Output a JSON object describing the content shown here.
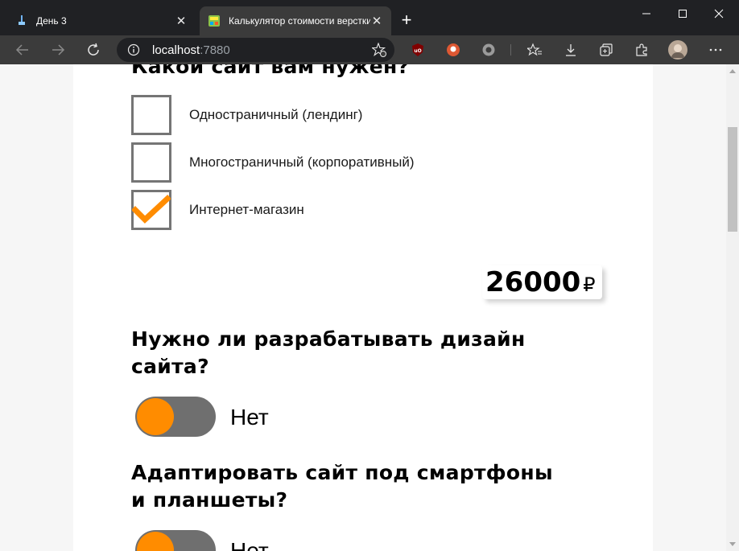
{
  "browser": {
    "tabs": [
      {
        "title": "День 3",
        "active": false
      },
      {
        "title": "Калькулятор стоимости верстки",
        "active": true
      }
    ],
    "address": {
      "host": "localhost",
      "port": ":7880"
    }
  },
  "page": {
    "site_type": {
      "heading": "Какой сайт вам нужен?",
      "options": [
        {
          "label": "Одностраничный (лендинг)",
          "checked": false
        },
        {
          "label": "Многостраничный (корпоративный)",
          "checked": false
        },
        {
          "label": "Интернет-магазин",
          "checked": true
        }
      ]
    },
    "total": {
      "value": "26000",
      "currency": "₽"
    },
    "design": {
      "question_line1": "Нужно ли разрабатывать дизайн",
      "question_line2": "сайта?",
      "toggle_label": "Нет",
      "enabled": false
    },
    "adaptive": {
      "question_line1": "Адаптировать сайт под смартфоны",
      "question_line2": "и планшеты?",
      "toggle_label": "Нет",
      "enabled": false
    }
  },
  "colors": {
    "accent": "#ff8c00",
    "toggle_track": "#6f6f6f",
    "checkbox_border": "#757575",
    "chrome_dark": "#202124"
  }
}
